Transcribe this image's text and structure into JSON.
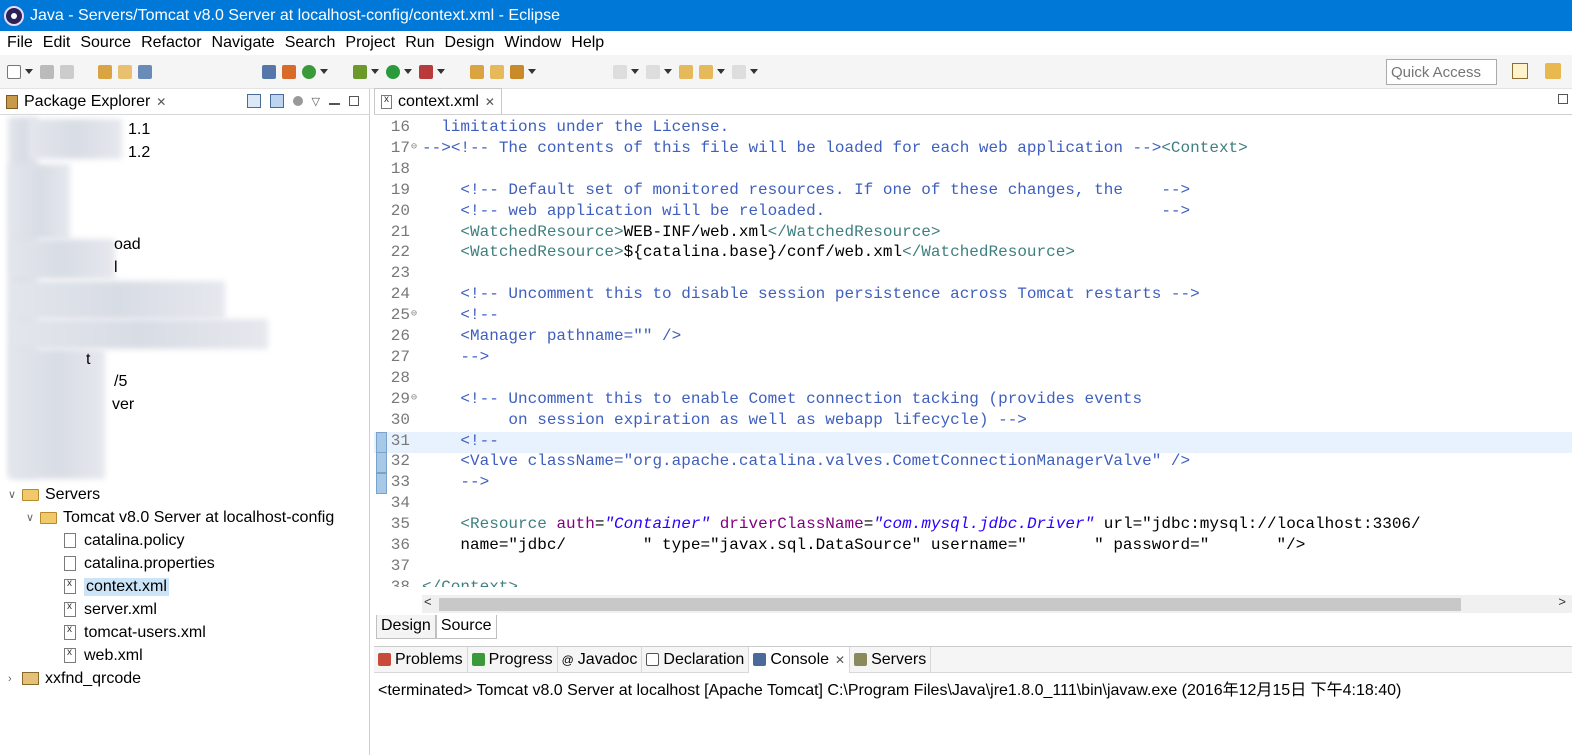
{
  "window": {
    "title": "Java - Servers/Tomcat v8.0 Server at localhost-config/context.xml - Eclipse"
  },
  "menu": [
    "File",
    "Edit",
    "Source",
    "Refactor",
    "Navigate",
    "Search",
    "Project",
    "Run",
    "Design",
    "Window",
    "Help"
  ],
  "quick_access": {
    "placeholder": "Quick Access"
  },
  "package_explorer": {
    "tab_label": "Package Explorer",
    "blurred_fragments": [
      "1.1",
      "1.2",
      "oad",
      "l",
      "t",
      "/5",
      "ver"
    ],
    "servers_label": "Servers",
    "tomcat_config_label": "Tomcat v8.0 Server at localhost-config",
    "files": [
      "catalina.policy",
      "catalina.properties",
      "context.xml",
      "server.xml",
      "tomcat-users.xml",
      "web.xml"
    ],
    "last_project": "xxfnd_qrcode"
  },
  "editor": {
    "tab_label": "context.xml",
    "lines": [
      {
        "n": "16",
        "text": "  limitations under the License."
      },
      {
        "n": "17",
        "text": "--><!-- The contents of this file will be loaded for each web application --><Context>"
      },
      {
        "n": "18",
        "text": ""
      },
      {
        "n": "19",
        "text": "    <!-- Default set of monitored resources. If one of these changes, the    -->"
      },
      {
        "n": "20",
        "text": "    <!-- web application will be reloaded.                                   -->"
      },
      {
        "n": "21",
        "text": "    <WatchedResource>WEB-INF/web.xml</WatchedResource>"
      },
      {
        "n": "22",
        "text": "    <WatchedResource>${catalina.base}/conf/web.xml</WatchedResource>"
      },
      {
        "n": "23",
        "text": ""
      },
      {
        "n": "24",
        "text": "    <!-- Uncomment this to disable session persistence across Tomcat restarts -->"
      },
      {
        "n": "25",
        "text": "    <!--"
      },
      {
        "n": "26",
        "text": "    <Manager pathname=\"\" />"
      },
      {
        "n": "27",
        "text": "    -->"
      },
      {
        "n": "28",
        "text": ""
      },
      {
        "n": "29",
        "text": "    <!-- Uncomment this to enable Comet connection tacking (provides events"
      },
      {
        "n": "30",
        "text": "         on session expiration as well as webapp lifecycle) -->"
      },
      {
        "n": "31",
        "text": "    <!--"
      },
      {
        "n": "32",
        "text": "    <Valve className=\"org.apache.catalina.valves.CometConnectionManagerValve\" />"
      },
      {
        "n": "33",
        "text": "    -->"
      },
      {
        "n": "34",
        "text": ""
      },
      {
        "n": "35",
        "text": "    <Resource auth=\"Container\" driverClassName=\"com.mysql.jdbc.Driver\" url=\"jdbc:mysql://localhost:3306/"
      },
      {
        "n": "36",
        "text": "    name=\"jdbc/        \" type=\"javax.sql.DataSource\" username=\"       \" password=\"       \"/>"
      },
      {
        "n": "37",
        "text": ""
      },
      {
        "n": "38",
        "text": "</Context>"
      }
    ],
    "bottom_tabs": [
      "Design",
      "Source"
    ]
  },
  "console": {
    "tabs": [
      "Problems",
      "Progress",
      "Javadoc",
      "Declaration",
      "Console",
      "Servers"
    ],
    "active_tab": "Console",
    "output": "<terminated> Tomcat v8.0 Server at localhost [Apache Tomcat] C:\\Program Files\\Java\\jre1.8.0_111\\bin\\javaw.exe (2016年12月15日 下午4:18:40)"
  },
  "colors": {
    "titlebar": "#0078d7",
    "comment": "#3f5fbf",
    "tag": "#3f7f7f",
    "attr": "#7f007f",
    "value": "#2a00ff"
  }
}
